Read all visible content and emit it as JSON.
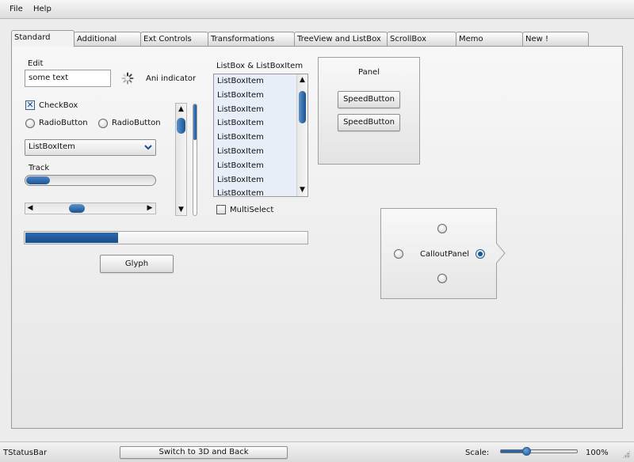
{
  "menu": {
    "file": "File",
    "help": "Help"
  },
  "tabs": [
    {
      "label": "Standard",
      "active": true
    },
    {
      "label": "Additional"
    },
    {
      "label": "Ext Controls"
    },
    {
      "label": "Transformations"
    },
    {
      "label": "TreeView and ListBox"
    },
    {
      "label": "ScrollBox"
    },
    {
      "label": "Memo"
    },
    {
      "label": "New !"
    }
  ],
  "standard": {
    "edit_label": "Edit",
    "edit_value": "some text",
    "ani_indicator_label": "Ani indicator",
    "checkbox_label": "CheckBox",
    "checkbox_checked": true,
    "radio1_label": "RadioButton",
    "radio2_label": "RadioButton",
    "combo_value": "ListBoxItem",
    "track_label": "Track",
    "track_value_fraction": 0.18,
    "hscroll_value_fraction": 0.45,
    "vscroll_value_fraction": 0.2,
    "listbox_title": "ListBox & ListBoxItem",
    "listbox_items": [
      "ListBoxItem",
      "ListBoxItem",
      "ListBoxItem",
      "ListBoxItem",
      "ListBoxItem",
      "ListBoxItem",
      "ListBoxItem",
      "ListBoxItem",
      "ListBoxItem"
    ],
    "multiselect_label": "MultiSelect",
    "multiselect_checked": false,
    "progress_fraction": 0.33,
    "glyph_button": "Glyph",
    "panel_title": "Panel",
    "speedbutton1": "SpeedButton",
    "speedbutton2": "SpeedButton",
    "callout_label": "CalloutPanel"
  },
  "statusbar": {
    "text": "TStatusBar",
    "switch_button": "Switch to 3D and Back",
    "scale_label": "Scale:",
    "scale_value": "100%",
    "scale_fraction": 0.3
  },
  "colors": {
    "accent": "#1c5593",
    "listbox_bg": "#e7eef8"
  }
}
